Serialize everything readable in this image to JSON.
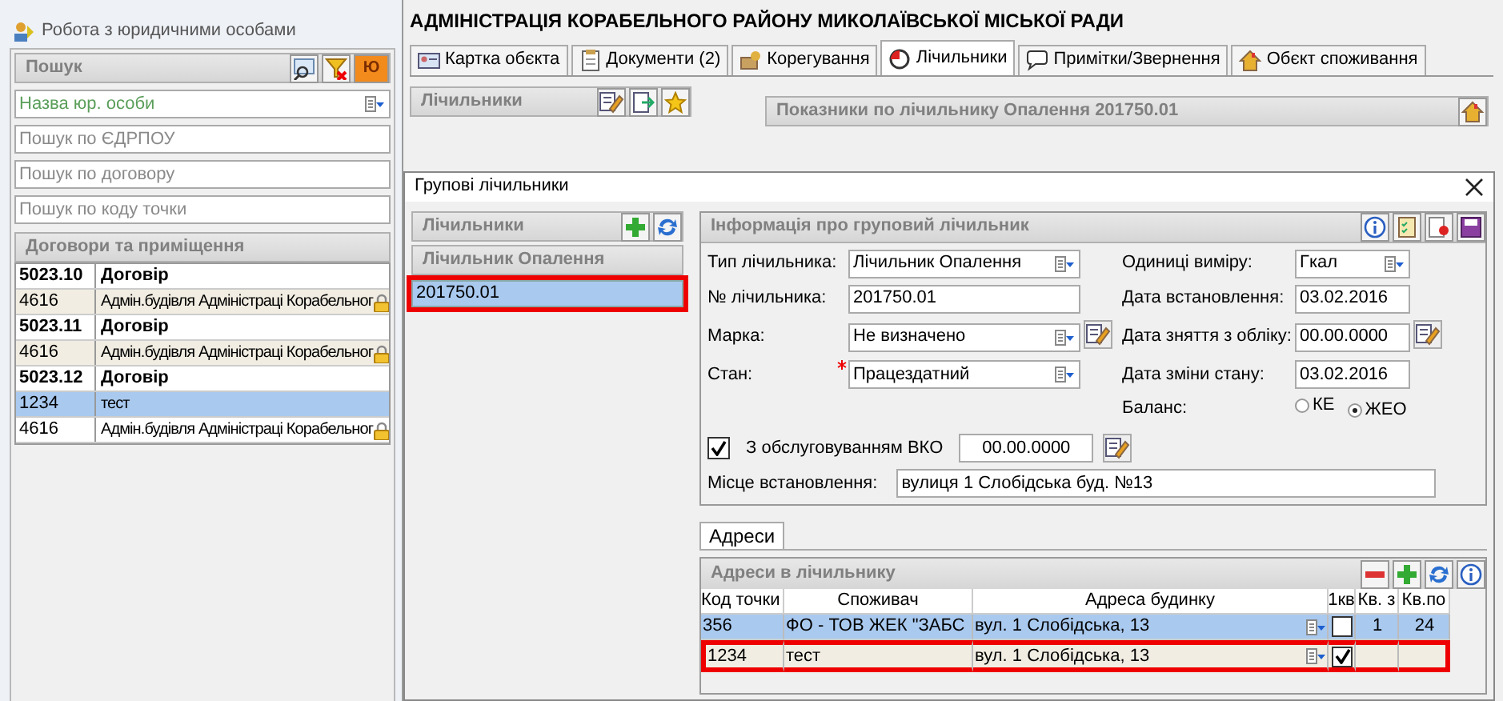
{
  "window": {
    "title": "Робота з юридичними особами"
  },
  "search_panel": {
    "title": "Пошук",
    "badge_button": "Ю",
    "fields": [
      {
        "placeholder": "Назва юр. особи",
        "kind": "dropdown"
      },
      {
        "placeholder": "Пошук по ЄДРПОУ",
        "kind": "text"
      },
      {
        "placeholder": "Пошук по договору",
        "kind": "text"
      },
      {
        "placeholder": "Пошук по коду точки",
        "kind": "text"
      }
    ]
  },
  "contracts": {
    "title": "Договори та приміщення",
    "rows": [
      {
        "kind": "contract",
        "code": "5023.10",
        "name": "Договір",
        "selected": false,
        "locked": false
      },
      {
        "kind": "premise",
        "code": "4616",
        "name": "Адмін.будівля Адміністраці Корабельног",
        "selected": false,
        "locked": true
      },
      {
        "kind": "contract",
        "code": "5023.11",
        "name": "Договір",
        "selected": false,
        "locked": false
      },
      {
        "kind": "premise",
        "code": "4616",
        "name": "Адмін.будівля Адміністраці Корабельног",
        "selected": false,
        "locked": true
      },
      {
        "kind": "contract",
        "code": "5023.12",
        "name": "Договір",
        "selected": false,
        "locked": false
      },
      {
        "kind": "premise",
        "code": "1234",
        "name": "тест",
        "selected": true,
        "locked": false
      },
      {
        "kind": "premise",
        "code": "4616",
        "name": "Адмін.будівля Адміністраці Корабельног",
        "selected": false,
        "locked": true
      }
    ]
  },
  "organization": {
    "title": "АДМІНІСТРАЦІЯ КОРАБЕЛЬНОГО РАЙОНУ МИКОЛАЇВСЬКОЇ МІСЬКОЇ РАДИ"
  },
  "tabs": [
    {
      "label": "Картка обєкта",
      "kind": "card",
      "selected": false
    },
    {
      "label": "Документи (2)",
      "kind": "docs",
      "selected": false
    },
    {
      "label": "Корегування",
      "kind": "adjust",
      "selected": false
    },
    {
      "label": "Лічильники",
      "kind": "meter",
      "selected": true
    },
    {
      "label": "Примітки/Звернення",
      "kind": "note",
      "selected": false
    },
    {
      "label": "Обєкт споживання",
      "kind": "house",
      "selected": false
    }
  ],
  "meters_panel": {
    "title": "Лічильники"
  },
  "readings_panel": {
    "title": "Показники по лічильнику Опалення 201750.01"
  },
  "dialog": {
    "title": "Групові лічильники",
    "meter_list": {
      "title": "Лічильники",
      "group": "Лічильник Опалення",
      "items": [
        {
          "label": "201750.01",
          "selected": true,
          "highlighted": true
        }
      ]
    },
    "info": {
      "title": "Інформація про груповий лічильник",
      "left_fields": [
        {
          "label": "Тип лічильника:",
          "value": "Лічильник Опалення",
          "kind": "dropdown",
          "required": false,
          "editable": false
        },
        {
          "label": "№ лічильника:",
          "value": "201750.01",
          "kind": "text",
          "required": false,
          "editable": false
        },
        {
          "label": "Марка:",
          "value": "Не визначено",
          "kind": "dropdown",
          "required": false,
          "editable": true
        },
        {
          "label": "Стан:",
          "value": "Працездатний",
          "kind": "dropdown",
          "required": true,
          "editable": false
        }
      ],
      "right_fields": [
        {
          "label": "Одиниці виміру:",
          "value": "Гкал",
          "kind": "dropdown",
          "editable": false
        },
        {
          "label": "Дата встановлення:",
          "value": "03.02.2016",
          "kind": "date",
          "editable": false
        },
        {
          "label": "Дата зняття з обліку:",
          "value": "00.00.0000",
          "kind": "date",
          "editable": true
        },
        {
          "label": "Дата зміни стану:",
          "value": "03.02.2016",
          "kind": "date",
          "editable": false
        }
      ],
      "balance": {
        "label": "Баланс:",
        "options": [
          {
            "label": "КЕ",
            "selected": false
          },
          {
            "label": "ЖЕО",
            "selected": true
          }
        ]
      },
      "vko": {
        "label": "З обслуговуванням ВКО",
        "checked": true,
        "date": "00.00.0000"
      },
      "location": {
        "label": "Місце встановлення:",
        "value": "вулиця 1 Слобідська буд. №13"
      }
    },
    "inner_tabs": [
      {
        "label": "Адреси",
        "selected": true
      }
    ],
    "addresses": {
      "title": "Адреси в лічильнику",
      "columns": [
        "Код точки",
        "Споживач",
        "Адреса будинку",
        "1кв",
        "Кв. з",
        "Кв.по"
      ],
      "rows": [
        {
          "code": "356",
          "consumer": "ФО - ТОВ ЖЕК \"ЗАБС",
          "address": "вул. 1 Слобідська, 13",
          "first_flat": false,
          "flat_from": "1",
          "flat_to": "24",
          "selected": true,
          "highlighted": false
        },
        {
          "code": "1234",
          "consumer": "тест",
          "address": "вул. 1 Слобідська, 13",
          "first_flat": true,
          "selected": false,
          "highlighted": true
        }
      ]
    }
  }
}
